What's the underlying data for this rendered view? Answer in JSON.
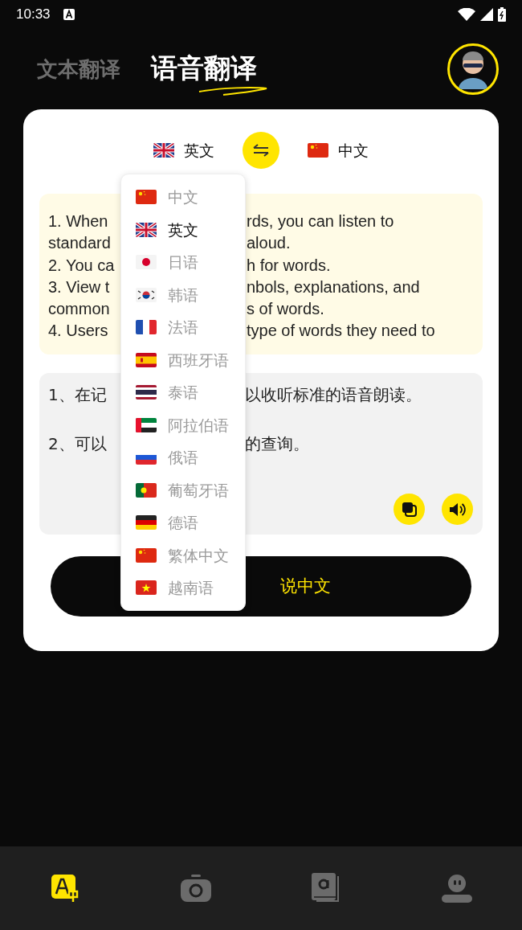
{
  "status_bar": {
    "time": "10:33"
  },
  "header": {
    "tabs": [
      {
        "label": "文本翻译",
        "selected": false
      },
      {
        "label": "语音翻译",
        "selected": true
      }
    ]
  },
  "language_bar": {
    "source": {
      "label": "英文",
      "kind": "gb"
    },
    "target": {
      "label": "中文",
      "kind": "cn"
    }
  },
  "source_text": {
    "lines": [
      {
        "left": "1. When",
        "right": "rds, you can listen to"
      },
      {
        "left": "standard",
        "right": "aloud."
      },
      {
        "left": "2. You ca",
        "right": "h for words."
      },
      {
        "left": "3. View t",
        "right": "nbols, explanations, and"
      },
      {
        "left": "common",
        "right": "s of words."
      },
      {
        "left": "4. Users",
        "right": "type of words they need to"
      }
    ]
  },
  "translation": {
    "lines": [
      {
        "left": "1、在记",
        "right": "以收听标准的语音朗读。"
      },
      {
        "left": "2、可以",
        "right": "的查询。"
      }
    ]
  },
  "speak_button": {
    "label": "说中文"
  },
  "language_menu": {
    "items": [
      {
        "label": "中文",
        "kind": "cn",
        "selected": false
      },
      {
        "label": "英文",
        "kind": "gb",
        "selected": true
      },
      {
        "label": "日语",
        "kind": "jp",
        "selected": false
      },
      {
        "label": "韩语",
        "kind": "kr",
        "selected": false
      },
      {
        "label": "法语",
        "kind": "fr",
        "selected": false
      },
      {
        "label": "西班牙语",
        "kind": "es",
        "selected": false
      },
      {
        "label": "泰语",
        "kind": "th",
        "selected": false
      },
      {
        "label": "阿拉伯语",
        "kind": "ae",
        "selected": false
      },
      {
        "label": "俄语",
        "kind": "ru",
        "selected": false
      },
      {
        "label": "葡萄牙语",
        "kind": "pt",
        "selected": false
      },
      {
        "label": "德语",
        "kind": "de",
        "selected": false
      },
      {
        "label": "繁体中文",
        "kind": "cn",
        "selected": false
      },
      {
        "label": "越南语",
        "kind": "vn",
        "selected": false
      }
    ]
  },
  "bottom_nav": [
    {
      "kind": "translate",
      "selected": true
    },
    {
      "kind": "camera",
      "selected": false
    },
    {
      "kind": "book",
      "selected": false
    },
    {
      "kind": "profile",
      "selected": false
    }
  ]
}
